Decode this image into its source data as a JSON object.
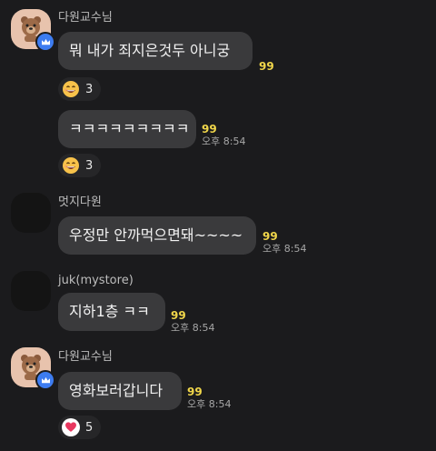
{
  "messages": [
    {
      "sender": "다원교수님",
      "text": "뭐 내가 죄지은것두 아니궁",
      "unread": "99"
    },
    {
      "text": "ㅋㅋㅋㅋㅋㅋㅋㅋㅋ",
      "unread": "99",
      "time": "오후 8:54"
    },
    {
      "sender": "멋지다원",
      "text": "우정만 안까먹으면돼~~~~",
      "unread": "99",
      "time": "오후 8:54"
    },
    {
      "sender": "juk(mystore)",
      "text": "지하1층 ㅋㅋ",
      "unread": "99",
      "time": "오후 8:54"
    },
    {
      "sender": "다원교수님",
      "text": "영화보러갑니다",
      "unread": "99",
      "time": "오후 8:54"
    }
  ],
  "reactions": [
    {
      "emoji": "grinning-face-icon",
      "count": "3"
    },
    {
      "emoji": "grinning-face-icon",
      "count": "3"
    },
    {
      "emoji": "heart-icon",
      "count": "5",
      "color": "#e8375f"
    }
  ],
  "colors": {
    "background": "#1b1b1d",
    "bubble": "#3a3a3c",
    "unread": "#f0d64a",
    "badge": "#3d7cf0"
  }
}
